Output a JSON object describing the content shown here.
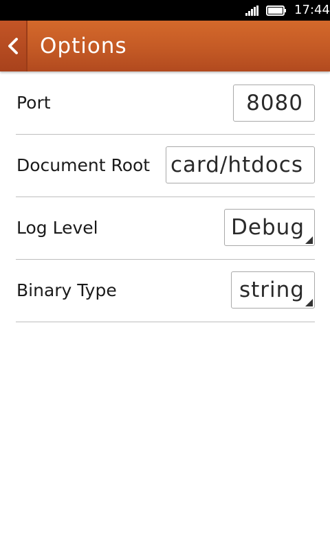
{
  "status_bar": {
    "time": "17:44",
    "signal_icon": "signal-icon",
    "battery_icon": "battery-icon"
  },
  "header": {
    "title": "Options",
    "back_icon": "chevron-left-icon",
    "gradient_top": "#d4692b",
    "gradient_bottom": "#b24a1f"
  },
  "form": {
    "port": {
      "label": "Port",
      "value": "8080"
    },
    "document_root": {
      "label": "Document Root",
      "value": "card/htdocs"
    },
    "log_level": {
      "label": "Log Level",
      "value": "Debug"
    },
    "binary_type": {
      "label": "Binary Type",
      "value": "string"
    }
  }
}
